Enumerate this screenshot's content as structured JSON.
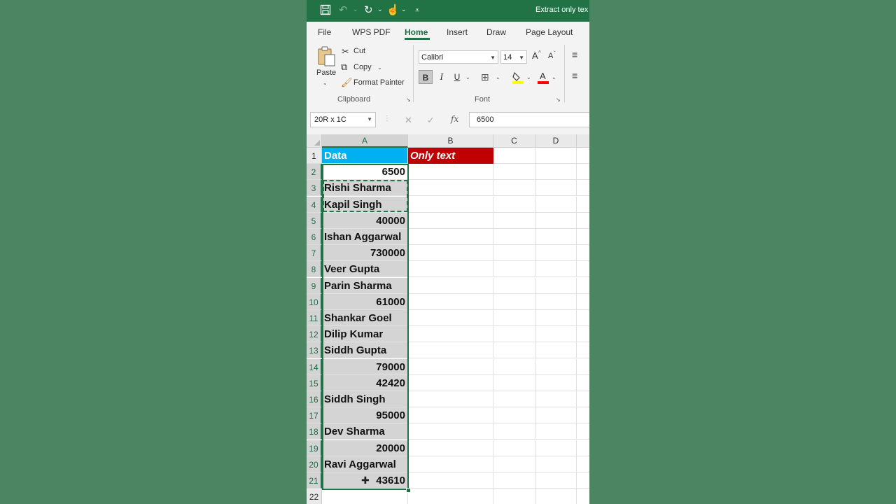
{
  "titlebar": {
    "title": "Extract only tex"
  },
  "tabs": [
    "File",
    "WPS PDF",
    "Home",
    "Insert",
    "Draw",
    "Page Layout"
  ],
  "active_tab": "Home",
  "ribbon": {
    "clipboard": {
      "paste": "Paste",
      "cut": "Cut",
      "copy": "Copy",
      "format_painter": "Format Painter",
      "group_label": "Clipboard"
    },
    "font": {
      "font_name": "Calibri",
      "font_size": "14",
      "bold": "B",
      "italic": "I",
      "underline": "U",
      "grow": "A",
      "shrink": "A",
      "font_color": "A",
      "group_label": "Font"
    }
  },
  "formula_bar": {
    "name_box": "20R x 1C",
    "cancel": "✕",
    "enter": "✓",
    "fx": "fx",
    "value": "6500"
  },
  "columns": [
    "A",
    "B",
    "C",
    "D"
  ],
  "rows": [
    "1",
    "2",
    "3",
    "4",
    "5",
    "6",
    "7",
    "8",
    "9",
    "10",
    "11",
    "12",
    "13",
    "14",
    "15",
    "16",
    "17",
    "18",
    "19",
    "20",
    "21",
    "22"
  ],
  "cells": {
    "A1": "Data",
    "B1": "Only text",
    "A": [
      "6500",
      "Rishi Sharma",
      "Kapil Singh",
      "40000",
      "Ishan Aggarwal",
      "730000",
      "Veer Gupta",
      "Parin Sharma",
      "61000",
      "Shankar Goel",
      "Dilip Kumar",
      "Siddh Gupta",
      "79000",
      "42420",
      "Siddh Singh",
      "95000",
      "Dev Sharma",
      "20000",
      "Ravi Aggarwal",
      "43610"
    ]
  },
  "colors": {
    "excel_green": "#217346",
    "header_blue": "#00b0f0",
    "header_red": "#c00000",
    "background": "#4a8460"
  }
}
